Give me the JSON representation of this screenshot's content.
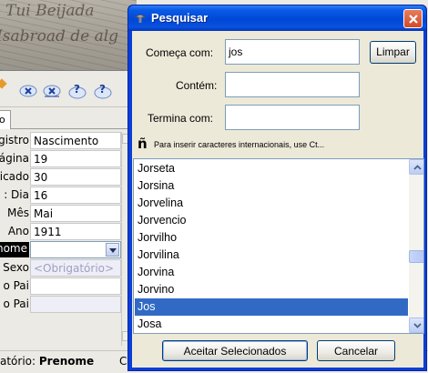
{
  "background": {
    "doc_script": [
      "Tui Beijada",
      "Isabroad de alg"
    ],
    "tab_label": "o",
    "form_rows": [
      {
        "label": "gistro",
        "value": "Nascimento",
        "kind": "text"
      },
      {
        "label": "ágina",
        "value": "19",
        "kind": "text"
      },
      {
        "label": "icado",
        "value": "30",
        "kind": "text"
      },
      {
        "label": ": Dia",
        "value": "16",
        "kind": "text"
      },
      {
        "label": "Mês",
        "value": "Mai",
        "kind": "text"
      },
      {
        "label": "Ano",
        "value": "1911",
        "kind": "text"
      },
      {
        "label": "nome",
        "value": "",
        "kind": "combo"
      },
      {
        "label": "Sexo",
        "value": "<Obrigatório>",
        "kind": "placeholder"
      },
      {
        "label": "o Pai",
        "value": "",
        "kind": "text"
      },
      {
        "label": "o Pai",
        "value": "",
        "kind": "blank"
      }
    ],
    "status_left_prefix": "atório:",
    "status_left_bold": "Prenome",
    "status_right": "Conclu"
  },
  "dialog": {
    "title": "Pesquisar",
    "starts_with_label": "Começa com:",
    "starts_with_value": "jos",
    "clear_button": "Limpar",
    "contains_label": "Contém:",
    "contains_value": "",
    "ends_with_label": "Termina com:",
    "ends_with_value": "",
    "hint_glyph": "ñ",
    "hint_text": "Para inserir caracteres internacionais, use Ct...",
    "results": [
      "Jorseta",
      "Jorsina",
      "Jorvelina",
      "Jorvencio",
      "Jorvilho",
      "Jorvilina",
      "Jorvina",
      "Jorvino",
      "Jos",
      "Josa"
    ],
    "selected_index": 8,
    "accept_button": "Aceitar Selecionados",
    "cancel_button": "Cancelar"
  },
  "colors": {
    "title_bar": "#0047d6",
    "selection": "#316ac5",
    "dialog_face": "#ece9d8"
  }
}
